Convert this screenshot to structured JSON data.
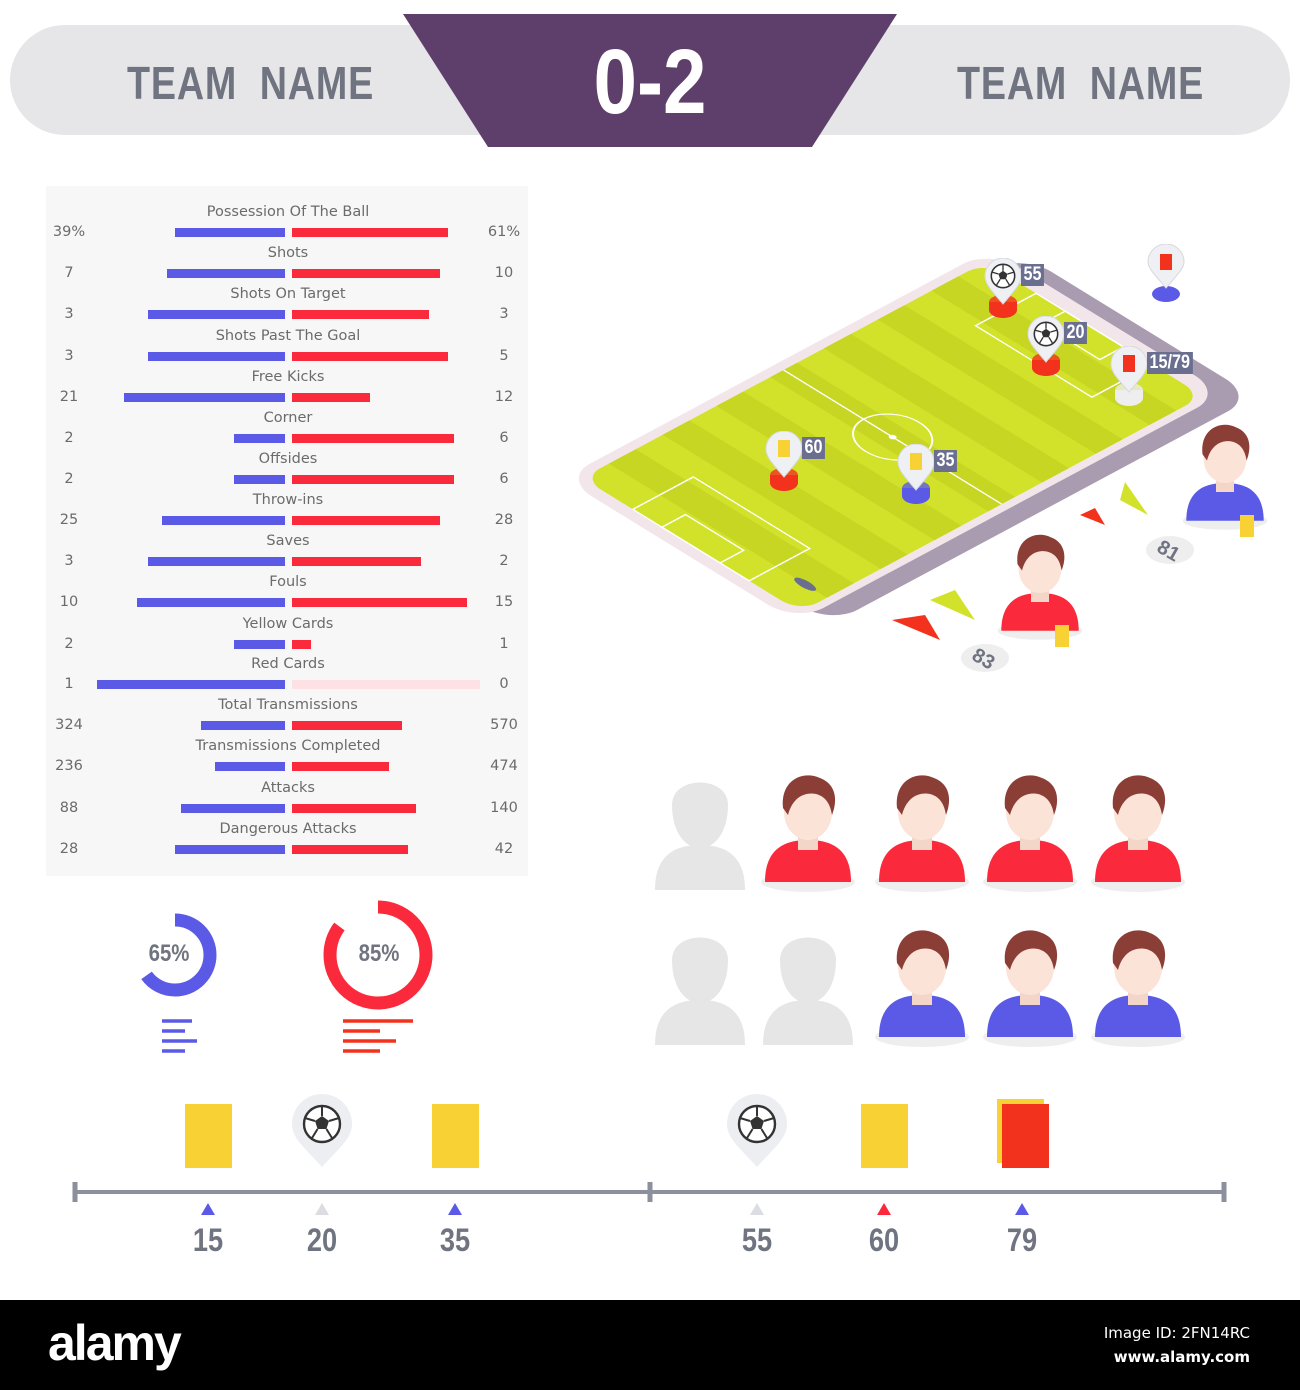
{
  "scoreboard": {
    "home_team": "TEAM  NAME",
    "away_team": "TEAM  NAME",
    "score": "0-2",
    "accent": "#5e3f6b"
  },
  "colors": {
    "home": "#5a5ae6",
    "away": "#fa2a3c",
    "away_faded": "#fde1e4",
    "pitch": "#d2e22a",
    "yellow_card": "#f8d235",
    "red_card": "#f3321e"
  },
  "chart_data": {
    "type": "bar",
    "categories": [
      "Possession Of  The Ball",
      "Shots",
      "Shots On Target",
      "Shots Past The Goal",
      "Free Kicks",
      "Corner",
      "Offsides",
      "Throw-ins",
      "Saves",
      "Fouls",
      "Yellow Cards",
      "Red Cards",
      "Total Transmissions",
      "Transmissions Completed",
      "Attacks",
      "Dangerous Attacks"
    ],
    "series": [
      {
        "labels": [
          "39%",
          "7",
          "3",
          "3",
          "21",
          "2",
          "2",
          "25",
          "3",
          "10",
          "2",
          "1",
          "324",
          "236",
          "88",
          "28"
        ],
        "fill": [
          0.58,
          0.62,
          0.72,
          0.72,
          0.85,
          0.27,
          0.27,
          0.65,
          0.72,
          0.78,
          0.27,
          0.99,
          0.44,
          0.37,
          0.55,
          0.58
        ]
      },
      {
        "labels": [
          "61%",
          "10",
          "3",
          "5",
          "12",
          "6",
          "6",
          "28",
          "2",
          "15",
          "1",
          "0",
          "570",
          "474",
          "140",
          "42"
        ],
        "fill": [
          0.82,
          0.78,
          0.72,
          0.82,
          0.41,
          0.85,
          0.85,
          0.78,
          0.68,
          0.92,
          0.1,
          0.99,
          0.58,
          0.51,
          0.65,
          0.61
        ]
      }
    ]
  },
  "donuts": [
    {
      "label": "65%",
      "value": 0.65,
      "color": "#5a5ae6"
    },
    {
      "label": "85%",
      "value": 0.85,
      "color": "#fa2a3c"
    }
  ],
  "pitch_markers": [
    {
      "icon": "ball-icon",
      "label": "55"
    },
    {
      "icon": "ball-icon",
      "label": "20"
    },
    {
      "icon": "red-card-icon",
      "label": "15/79"
    },
    {
      "icon": "yellow-card-icon",
      "label": "60"
    },
    {
      "icon": "yellow-card-icon",
      "label": "35"
    }
  ],
  "substitutions": [
    {
      "minute": "81"
    },
    {
      "minute": "83"
    }
  ],
  "timeline": [
    {
      "minute": "15",
      "event": "yellow-card",
      "team_color": "#5a5ae6"
    },
    {
      "minute": "20",
      "event": "goal",
      "team_color": "#dcdde2"
    },
    {
      "minute": "35",
      "event": "yellow-card",
      "team_color": "#5a5ae6"
    },
    {
      "minute": "55",
      "event": "goal",
      "team_color": "#dcdde2"
    },
    {
      "minute": "60",
      "event": "yellow-card",
      "team_color": "#fa2a3c"
    },
    {
      "minute": "79",
      "event": "red-card",
      "team_color": "#5a5ae6"
    }
  ],
  "footer": {
    "logo": "alamy",
    "image_id": "Image ID: 2FN14RC",
    "url": "www.alamy.com"
  }
}
